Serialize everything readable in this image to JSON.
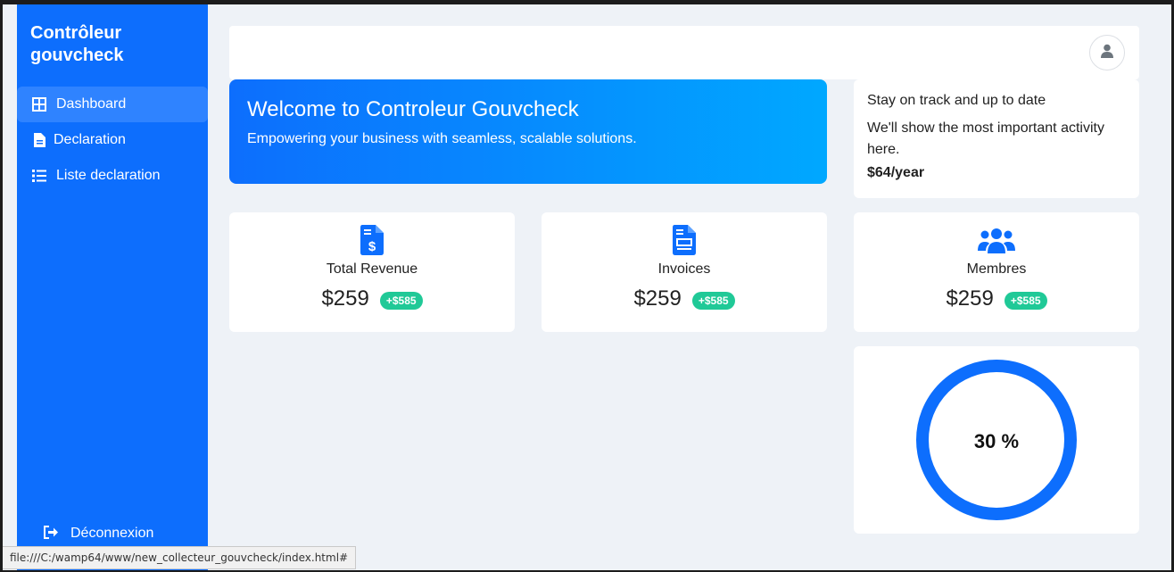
{
  "sidebar": {
    "brand": "Contrôleur gouvcheck",
    "items": [
      {
        "label": "Dashboard",
        "icon": "dashboard-grid-icon",
        "active": true
      },
      {
        "label": "Declaration",
        "icon": "file-icon"
      },
      {
        "label": "Liste declaration",
        "icon": "list-icon"
      }
    ],
    "logout": {
      "label": "Déconnexion",
      "icon": "logout-icon"
    }
  },
  "topbar": {
    "avatar_icon": "user-icon"
  },
  "welcome": {
    "title": "Welcome to Controleur Gouvcheck",
    "subtitle": "Empowering your business with seamless, scalable solutions."
  },
  "info_card": {
    "line1": "Stay on track and up to date",
    "line2": "We'll show the most important activity here.",
    "price": "$64/year"
  },
  "stats": [
    {
      "label": "Total Revenue",
      "value": "$259",
      "badge": "+$585",
      "icon": "invoice-dollar-icon"
    },
    {
      "label": "Invoices",
      "value": "$259",
      "badge": "+$585",
      "icon": "invoice-icon"
    },
    {
      "label": "Membres",
      "value": "$259",
      "badge": "+$585",
      "icon": "users-icon"
    }
  ],
  "progress": {
    "text": "30 %",
    "value": 0.3
  },
  "status_bar": {
    "url": "file:///C:/wamp64/www/new_collecteur_gouvcheck/index.html#"
  },
  "colors": {
    "primary": "#0d6efd",
    "sidebar_active": "#2f83ff",
    "background": "#eef2f7",
    "badge": "#20c997",
    "gradient_end": "#00a8ff"
  }
}
